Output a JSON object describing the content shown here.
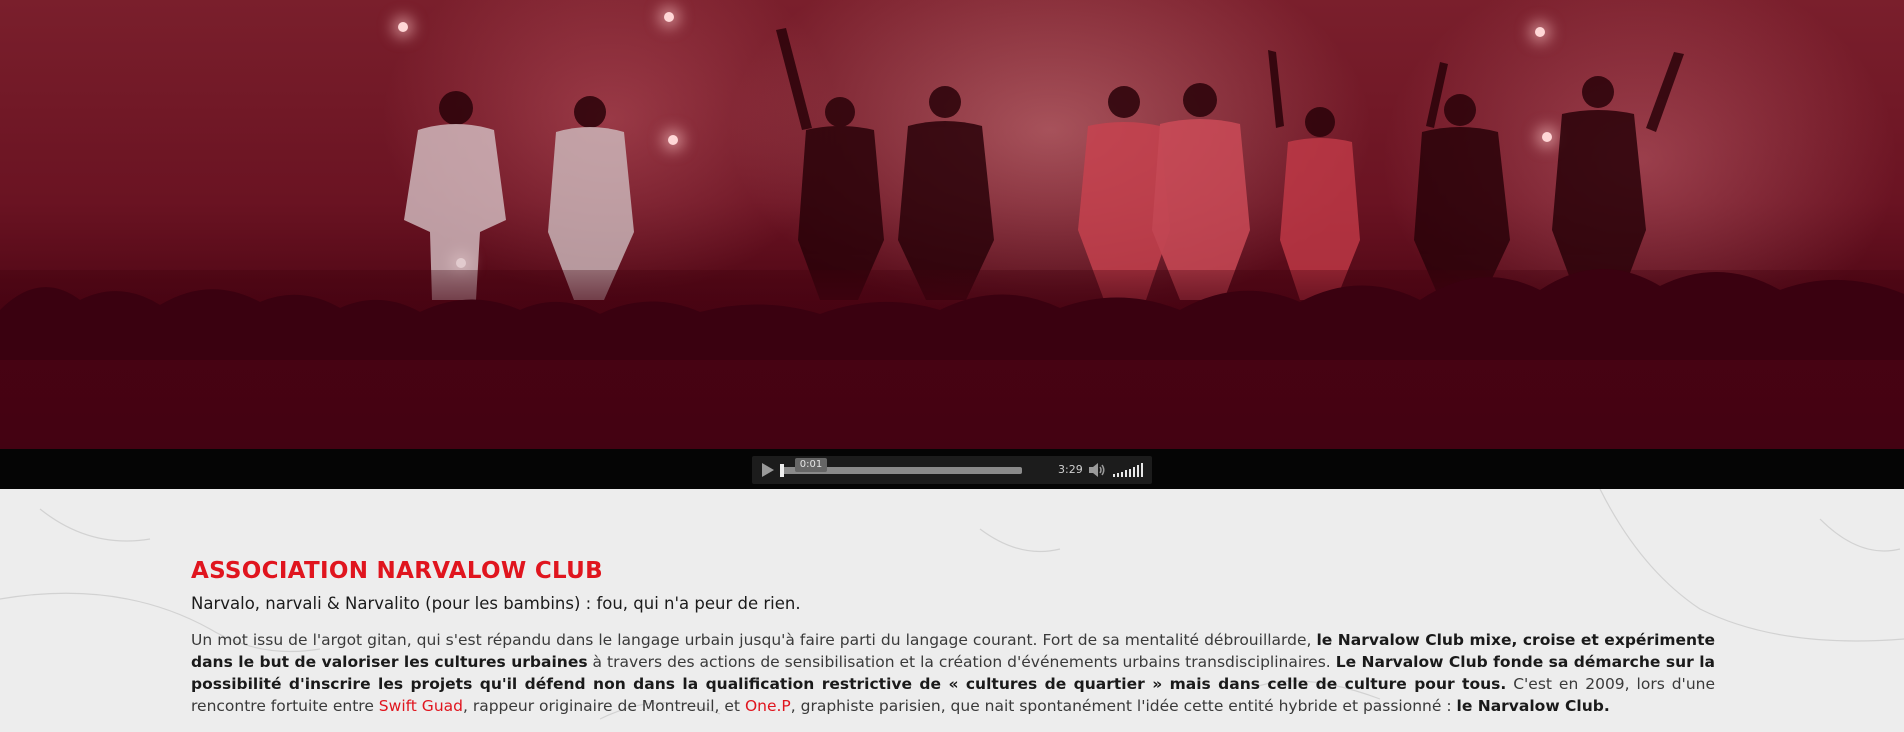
{
  "player": {
    "current_time": "0:01",
    "duration": "3:29",
    "progress": 0.0048
  },
  "article": {
    "title": "ASSOCIATION NARVALOW CLUB",
    "subtitle": "Narvalo, narvali & Narvalito (pour les bambins) : fou, qui n'a peur de rien.",
    "body": {
      "p1": "Un mot issu de l'argot gitan, qui s'est répandu dans le langage urbain jusqu'à faire parti du langage courant. Fort de sa mentalité débrouillarde, ",
      "b1": "le Narvalow Club mixe, croise et expérimente dans le but de valoriser les cultures urbaines",
      "p2": " à travers des actions de sensibilisation et la création d'événements urbains transdisciplinaires. ",
      "b2": "Le Narvalow Club fonde sa démarche sur la possibilité d'inscrire les projets qu'il défend non dans la qualification restrictive de « cultures de quartier » mais dans celle de culture pour tous.",
      "p3": " C'est en 2009, lors d'une rencontre fortuite entre ",
      "link1": "Swift Guad",
      "p4": ", rappeur originaire de Montreuil, et ",
      "link2": "One.P",
      "p5": ", graphiste parisien, que nait spontanément l'idée cette entité hybride et passionné : ",
      "b3": "le Narvalow Club."
    }
  },
  "colors": {
    "accent_red": "#e0151e",
    "hero_dark": "#430212",
    "player_bg": "#050505",
    "content_bg": "#ededed"
  },
  "icons": {
    "play": "play-icon",
    "mute": "speaker-icon",
    "volume": "volume-bars-icon"
  }
}
